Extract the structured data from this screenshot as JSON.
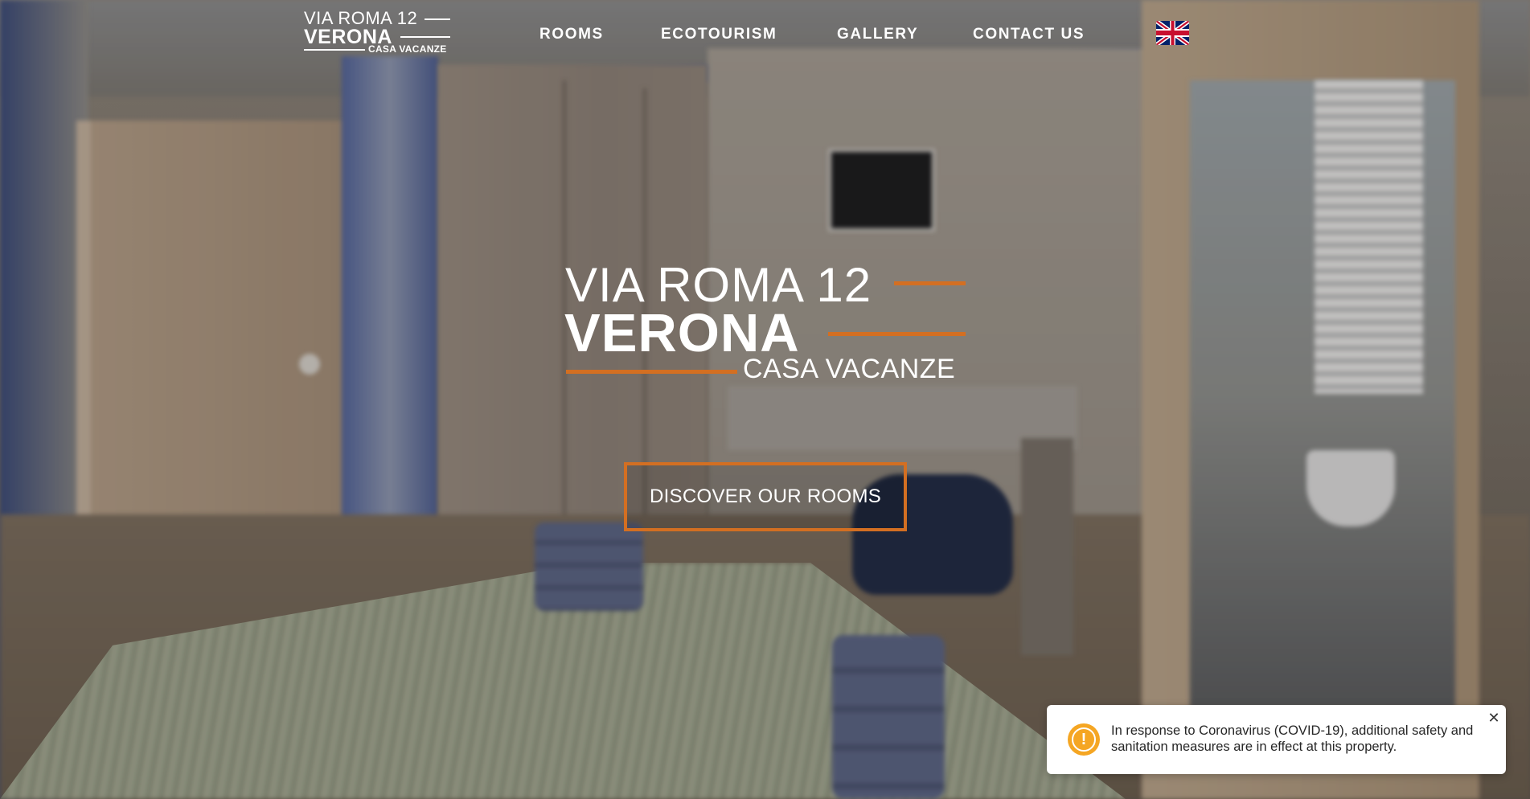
{
  "header": {
    "logo": {
      "line1": "VIA ROMA 12",
      "line2": "VERONA",
      "line3": "CASA VACANZE"
    },
    "nav": [
      {
        "label": "ROOMS"
      },
      {
        "label": "ECOTOURISM"
      },
      {
        "label": "GALLERY"
      },
      {
        "label": "CONTACT US"
      }
    ],
    "language_icon": "uk-flag-icon"
  },
  "hero": {
    "title_line1": "VIA ROMA 12",
    "title_line2": "VERONA",
    "title_line3": "CASA VACANZE",
    "cta_label": "DISCOVER OUR ROOMS",
    "accent_color": "#d36f22"
  },
  "notice": {
    "icon": "warning-icon",
    "icon_glyph": "!",
    "text": "In response to Coronavirus (COVID-19), additional safety and sanitation measures are in effect at this property.",
    "close_glyph": "✕"
  }
}
